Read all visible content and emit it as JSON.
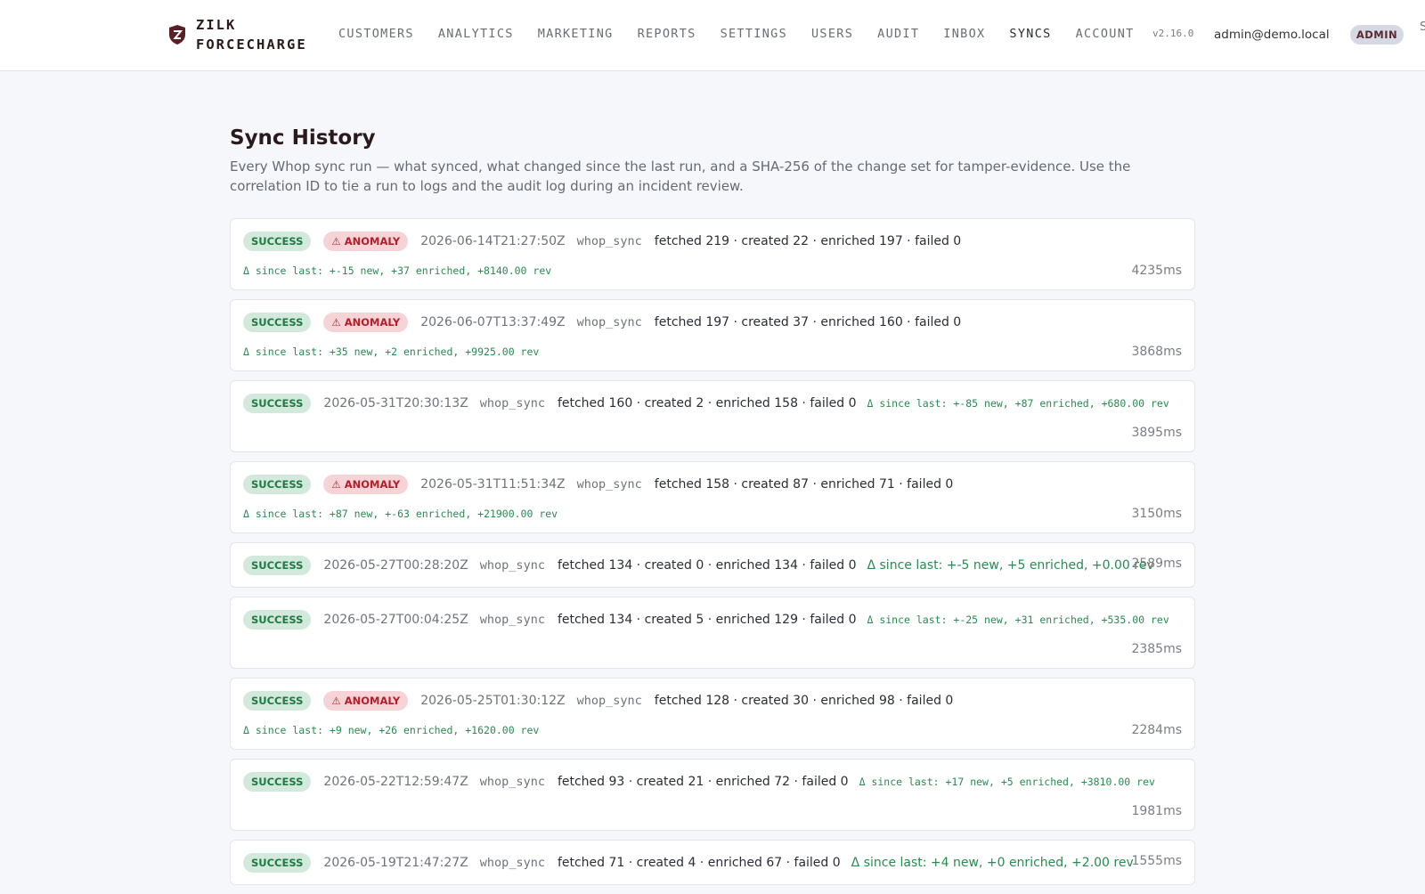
{
  "header": {
    "brand_line1": "ZILK",
    "brand_line2": "FORCECHARGE",
    "nav": [
      {
        "label": "CUSTOMERS"
      },
      {
        "label": "ANALYTICS"
      },
      {
        "label": "MARKETING"
      },
      {
        "label": "REPORTS"
      },
      {
        "label": "SETTINGS"
      },
      {
        "label": "USERS"
      },
      {
        "label": "AUDIT"
      },
      {
        "label": "INBOX"
      },
      {
        "label": "SYNCS",
        "active": true
      },
      {
        "label": "ACCOUNT"
      }
    ],
    "version": "v2.16.0",
    "user_email": "admin@demo.local",
    "role": "ADMIN",
    "clipped_text": "S"
  },
  "page": {
    "title": "Sync History",
    "description": "Every Whop sync run — what synced, what changed since the last run, and a SHA-256 of the change set for tamper-evidence. Use the correlation ID to tie a run to logs and the audit log during an incident review."
  },
  "labels": {
    "success": "SUCCESS",
    "anomaly": "⚠ ANOMALY"
  },
  "runs": [
    {
      "status": "SUCCESS",
      "anomaly": true,
      "timestamp": "2026-06-14T21:27:50Z",
      "source": "whop_sync",
      "stats": "fetched 219 · created 22 · enriched 197 · failed 0",
      "delta": "Δ since last: +-15 new, +37 enriched, +8140.00 rev",
      "duration": "4235ms"
    },
    {
      "status": "SUCCESS",
      "anomaly": true,
      "timestamp": "2026-06-07T13:37:49Z",
      "source": "whop_sync",
      "stats": "fetched 197 · created 37 · enriched 160 · failed 0",
      "delta": "Δ since last: +35 new, +2 enriched, +9925.00 rev",
      "duration": "3868ms"
    },
    {
      "status": "SUCCESS",
      "anomaly": false,
      "timestamp": "2026-05-31T20:30:13Z",
      "source": "whop_sync",
      "stats": "fetched 160 · created 2 · enriched 158 · failed 0",
      "delta": "Δ since last: +-85 new, +87 enriched, +680.00 rev",
      "duration": "3895ms"
    },
    {
      "status": "SUCCESS",
      "anomaly": true,
      "timestamp": "2026-05-31T11:51:34Z",
      "source": "whop_sync",
      "stats": "fetched 158 · created 87 · enriched 71 · failed 0",
      "delta": "Δ since last: +87 new, +-63 enriched, +21900.00 rev",
      "duration": "3150ms"
    },
    {
      "status": "SUCCESS",
      "anomaly": false,
      "timestamp": "2026-05-27T00:28:20Z",
      "source": "whop_sync",
      "stats": "fetched 134 · created 0 · enriched 134 · failed 0",
      "delta": "Δ since last: +-5 new, +5 enriched, +0.00 rev",
      "duration": "2589ms"
    },
    {
      "status": "SUCCESS",
      "anomaly": false,
      "timestamp": "2026-05-27T00:04:25Z",
      "source": "whop_sync",
      "stats": "fetched 134 · created 5 · enriched 129 · failed 0",
      "delta": "Δ since last: +-25 new, +31 enriched, +535.00 rev",
      "duration": "2385ms"
    },
    {
      "status": "SUCCESS",
      "anomaly": true,
      "timestamp": "2026-05-25T01:30:12Z",
      "source": "whop_sync",
      "stats": "fetched 128 · created 30 · enriched 98 · failed 0",
      "delta": "Δ since last: +9 new, +26 enriched, +1620.00 rev",
      "duration": "2284ms"
    },
    {
      "status": "SUCCESS",
      "anomaly": false,
      "timestamp": "2026-05-22T12:59:47Z",
      "source": "whop_sync",
      "stats": "fetched 93 · created 21 · enriched 72 · failed 0",
      "delta": "Δ since last: +17 new, +5 enriched, +3810.00 rev",
      "duration": "1981ms"
    },
    {
      "status": "SUCCESS",
      "anomaly": false,
      "timestamp": "2026-05-19T21:47:27Z",
      "source": "whop_sync",
      "stats": "fetched 71 · created 4 · enriched 67 · failed 0",
      "delta": "Δ since last: +4 new, +0 enriched, +2.00 rev",
      "duration": "1555ms"
    }
  ]
}
